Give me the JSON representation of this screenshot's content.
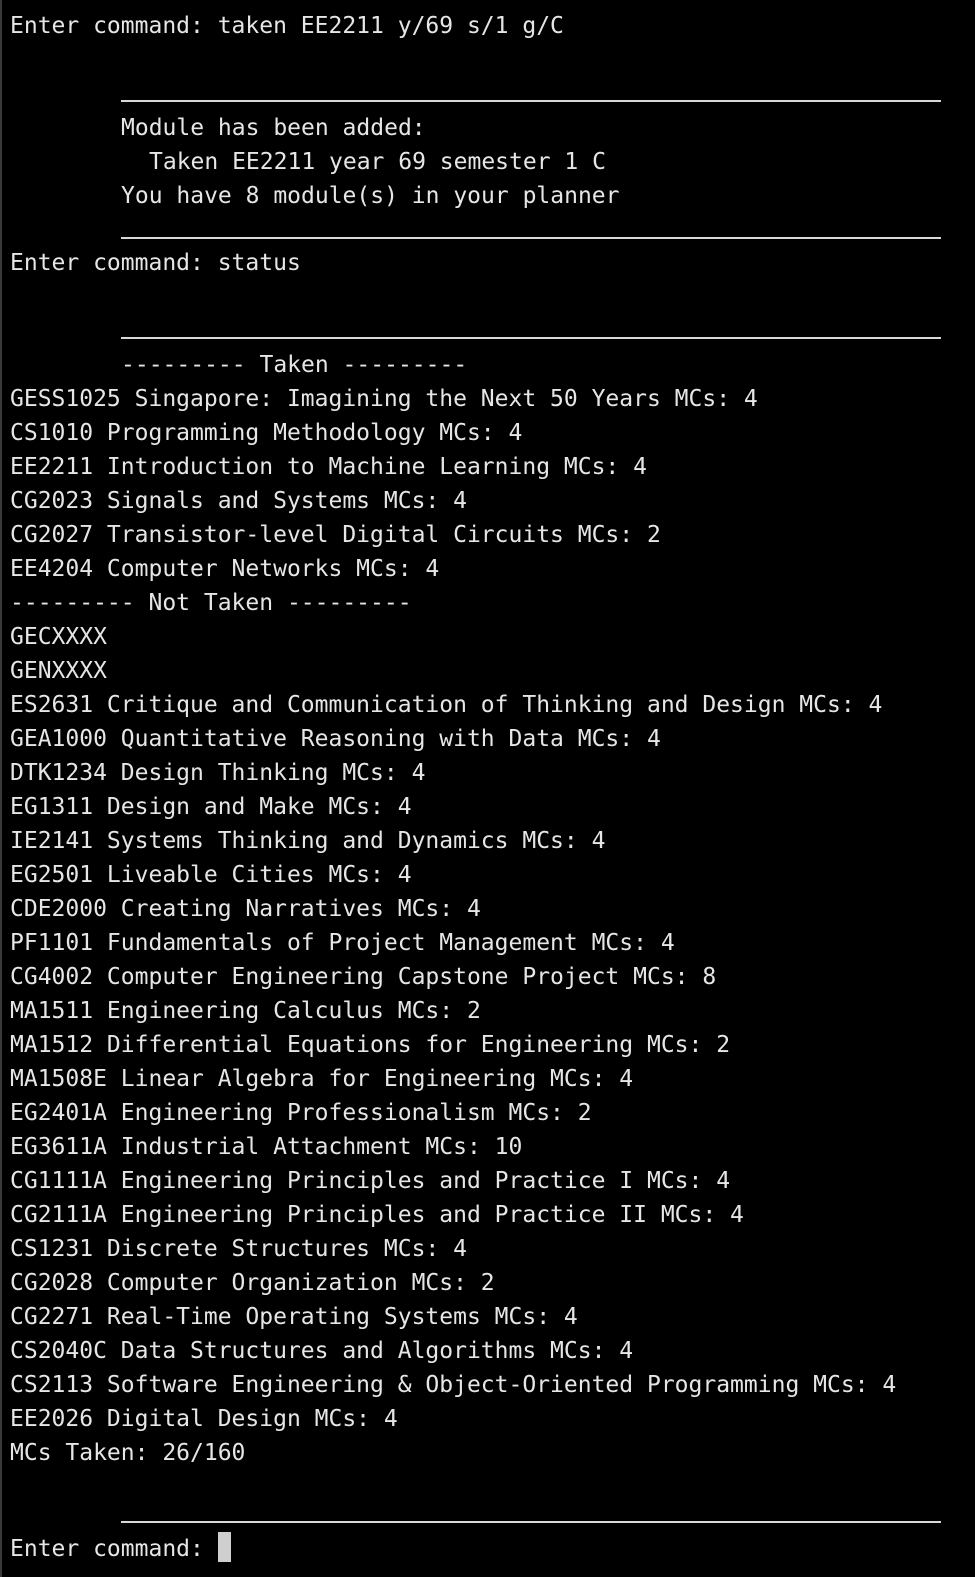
{
  "colors": {
    "background": "#000000",
    "text": "#e6e6e6",
    "cursor": "#cfcfcf"
  },
  "history": {
    "cmd1": "Enter command: taken EE2211 y/69 s/1 g/C",
    "added_msg": "Module has been added:",
    "added_detail": "Taken EE2211 year 69 semester 1 C",
    "count_msg": "You have 8 module(s) in your planner",
    "cmd2": "Enter command: status"
  },
  "status": {
    "taken_header": "--------- Taken ---------",
    "taken": [
      "GESS1025 Singapore: Imagining the Next 50 Years MCs: 4",
      "CS1010 Programming Methodology MCs: 4",
      "EE2211 Introduction to Machine Learning MCs: 4",
      "CG2023 Signals and Systems MCs: 4",
      "CG2027 Transistor-level Digital Circuits MCs: 2",
      "EE4204 Computer Networks MCs: 4"
    ],
    "not_taken_header": "--------- Not Taken ---------",
    "not_taken": [
      "GECXXXX",
      "GENXXXX",
      "ES2631 Critique and Communication of Thinking and Design MCs: 4",
      "GEA1000 Quantitative Reasoning with Data MCs: 4",
      "DTK1234 Design Thinking MCs: 4",
      "EG1311 Design and Make MCs: 4",
      "IE2141 Systems Thinking and Dynamics MCs: 4",
      "EG2501 Liveable Cities MCs: 4",
      "CDE2000 Creating Narratives MCs: 4",
      "PF1101 Fundamentals of Project Management MCs: 4",
      "CG4002 Computer Engineering Capstone Project MCs: 8",
      "MA1511 Engineering Calculus MCs: 2",
      "MA1512 Differential Equations for Engineering MCs: 2",
      "MA1508E Linear Algebra for Engineering MCs: 4",
      "EG2401A Engineering Professionalism MCs: 2",
      "EG3611A Industrial Attachment MCs: 10",
      "CG1111A Engineering Principles and Practice I MCs: 4",
      "CG2111A Engineering Principles and Practice II MCs: 4",
      "CS1231 Discrete Structures MCs: 4",
      "CG2028 Computer Organization MCs: 2",
      "CG2271 Real-Time Operating Systems MCs: 4",
      "CS2040C Data Structures and Algorithms MCs: 4",
      "CS2113 Software Engineering & Object-Oriented Programming MCs: 4",
      "EE2026 Digital Design MCs: 4"
    ],
    "mcs_taken": "MCs Taken: 26/160"
  },
  "prompt": {
    "label": "Enter command:"
  }
}
